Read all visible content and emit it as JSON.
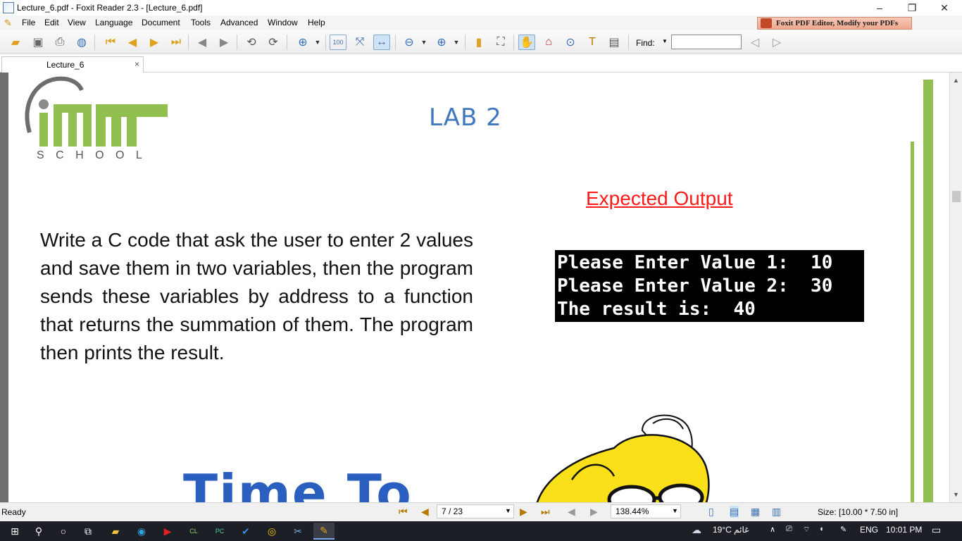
{
  "window": {
    "title": "Lecture_6.pdf - Foxit Reader 2.3 - [Lecture_6.pdf]",
    "minimize": "–",
    "restore": "❐",
    "close": "✕"
  },
  "menu": [
    "File",
    "Edit",
    "View",
    "Language",
    "Document",
    "Tools",
    "Advanced",
    "Window",
    "Help"
  ],
  "ad": {
    "label": "Foxit PDF Editor, Modify your PDFs"
  },
  "toolbar": {
    "find_label": "Find:",
    "find_value": ""
  },
  "tab": {
    "label": "Lecture_6",
    "close": "×"
  },
  "pdf": {
    "logo_letters": "iMT",
    "logo_school": "S C H O O L",
    "lab_title": "LAB 2",
    "expected_output": "Expected Output",
    "task_text": "Write a C code that ask the user to enter 2 values and save them in two variables, then the program sends these variables by address to a function that returns the summation of them. The program then prints the result.",
    "console_lines": [
      "Please Enter Value 1:  10",
      "Please Enter Value 2:  30",
      "The result is:  40"
    ],
    "bottom_heading": "Time To"
  },
  "status": {
    "text": "Ready",
    "page": "7 / 23",
    "zoom": "138.44%",
    "size": "Size: [10.00 * 7.50 in]"
  },
  "taskbar": {
    "weather": "19°C  غائم",
    "lang": "ENG",
    "time": "10:01 PM"
  },
  "colors": {
    "accent_green": "#92c050",
    "lab_blue": "#3f78bf",
    "expected_red": "#ff1a1a"
  }
}
